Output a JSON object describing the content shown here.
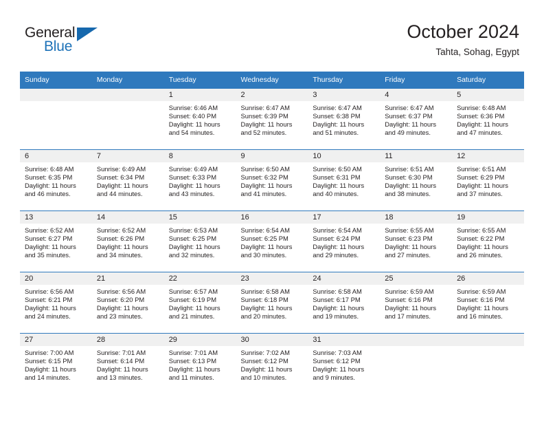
{
  "brand": {
    "line1": "General",
    "line2": "Blue",
    "flag_icon": "triangle-flag-icon",
    "accent_color": "#1668ad"
  },
  "header": {
    "title": "October 2024",
    "subtitle": "Tahta, Sohag, Egypt"
  },
  "colors": {
    "header_blue": "#2f79bd",
    "daynum_band": "#f0f0f0",
    "text": "#231f20"
  },
  "weekday_headers": [
    "Sunday",
    "Monday",
    "Tuesday",
    "Wednesday",
    "Thursday",
    "Friday",
    "Saturday"
  ],
  "weeks": [
    [
      {
        "day": "",
        "sunrise": "",
        "sunset": "",
        "daylight_line1": "",
        "daylight_line2": ""
      },
      {
        "day": "",
        "sunrise": "",
        "sunset": "",
        "daylight_line1": "",
        "daylight_line2": ""
      },
      {
        "day": "1",
        "sunrise": "Sunrise: 6:46 AM",
        "sunset": "Sunset: 6:40 PM",
        "daylight_line1": "Daylight: 11 hours",
        "daylight_line2": "and 54 minutes."
      },
      {
        "day": "2",
        "sunrise": "Sunrise: 6:47 AM",
        "sunset": "Sunset: 6:39 PM",
        "daylight_line1": "Daylight: 11 hours",
        "daylight_line2": "and 52 minutes."
      },
      {
        "day": "3",
        "sunrise": "Sunrise: 6:47 AM",
        "sunset": "Sunset: 6:38 PM",
        "daylight_line1": "Daylight: 11 hours",
        "daylight_line2": "and 51 minutes."
      },
      {
        "day": "4",
        "sunrise": "Sunrise: 6:47 AM",
        "sunset": "Sunset: 6:37 PM",
        "daylight_line1": "Daylight: 11 hours",
        "daylight_line2": "and 49 minutes."
      },
      {
        "day": "5",
        "sunrise": "Sunrise: 6:48 AM",
        "sunset": "Sunset: 6:36 PM",
        "daylight_line1": "Daylight: 11 hours",
        "daylight_line2": "and 47 minutes."
      }
    ],
    [
      {
        "day": "6",
        "sunrise": "Sunrise: 6:48 AM",
        "sunset": "Sunset: 6:35 PM",
        "daylight_line1": "Daylight: 11 hours",
        "daylight_line2": "and 46 minutes."
      },
      {
        "day": "7",
        "sunrise": "Sunrise: 6:49 AM",
        "sunset": "Sunset: 6:34 PM",
        "daylight_line1": "Daylight: 11 hours",
        "daylight_line2": "and 44 minutes."
      },
      {
        "day": "8",
        "sunrise": "Sunrise: 6:49 AM",
        "sunset": "Sunset: 6:33 PM",
        "daylight_line1": "Daylight: 11 hours",
        "daylight_line2": "and 43 minutes."
      },
      {
        "day": "9",
        "sunrise": "Sunrise: 6:50 AM",
        "sunset": "Sunset: 6:32 PM",
        "daylight_line1": "Daylight: 11 hours",
        "daylight_line2": "and 41 minutes."
      },
      {
        "day": "10",
        "sunrise": "Sunrise: 6:50 AM",
        "sunset": "Sunset: 6:31 PM",
        "daylight_line1": "Daylight: 11 hours",
        "daylight_line2": "and 40 minutes."
      },
      {
        "day": "11",
        "sunrise": "Sunrise: 6:51 AM",
        "sunset": "Sunset: 6:30 PM",
        "daylight_line1": "Daylight: 11 hours",
        "daylight_line2": "and 38 minutes."
      },
      {
        "day": "12",
        "sunrise": "Sunrise: 6:51 AM",
        "sunset": "Sunset: 6:29 PM",
        "daylight_line1": "Daylight: 11 hours",
        "daylight_line2": "and 37 minutes."
      }
    ],
    [
      {
        "day": "13",
        "sunrise": "Sunrise: 6:52 AM",
        "sunset": "Sunset: 6:27 PM",
        "daylight_line1": "Daylight: 11 hours",
        "daylight_line2": "and 35 minutes."
      },
      {
        "day": "14",
        "sunrise": "Sunrise: 6:52 AM",
        "sunset": "Sunset: 6:26 PM",
        "daylight_line1": "Daylight: 11 hours",
        "daylight_line2": "and 34 minutes."
      },
      {
        "day": "15",
        "sunrise": "Sunrise: 6:53 AM",
        "sunset": "Sunset: 6:25 PM",
        "daylight_line1": "Daylight: 11 hours",
        "daylight_line2": "and 32 minutes."
      },
      {
        "day": "16",
        "sunrise": "Sunrise: 6:54 AM",
        "sunset": "Sunset: 6:25 PM",
        "daylight_line1": "Daylight: 11 hours",
        "daylight_line2": "and 30 minutes."
      },
      {
        "day": "17",
        "sunrise": "Sunrise: 6:54 AM",
        "sunset": "Sunset: 6:24 PM",
        "daylight_line1": "Daylight: 11 hours",
        "daylight_line2": "and 29 minutes."
      },
      {
        "day": "18",
        "sunrise": "Sunrise: 6:55 AM",
        "sunset": "Sunset: 6:23 PM",
        "daylight_line1": "Daylight: 11 hours",
        "daylight_line2": "and 27 minutes."
      },
      {
        "day": "19",
        "sunrise": "Sunrise: 6:55 AM",
        "sunset": "Sunset: 6:22 PM",
        "daylight_line1": "Daylight: 11 hours",
        "daylight_line2": "and 26 minutes."
      }
    ],
    [
      {
        "day": "20",
        "sunrise": "Sunrise: 6:56 AM",
        "sunset": "Sunset: 6:21 PM",
        "daylight_line1": "Daylight: 11 hours",
        "daylight_line2": "and 24 minutes."
      },
      {
        "day": "21",
        "sunrise": "Sunrise: 6:56 AM",
        "sunset": "Sunset: 6:20 PM",
        "daylight_line1": "Daylight: 11 hours",
        "daylight_line2": "and 23 minutes."
      },
      {
        "day": "22",
        "sunrise": "Sunrise: 6:57 AM",
        "sunset": "Sunset: 6:19 PM",
        "daylight_line1": "Daylight: 11 hours",
        "daylight_line2": "and 21 minutes."
      },
      {
        "day": "23",
        "sunrise": "Sunrise: 6:58 AM",
        "sunset": "Sunset: 6:18 PM",
        "daylight_line1": "Daylight: 11 hours",
        "daylight_line2": "and 20 minutes."
      },
      {
        "day": "24",
        "sunrise": "Sunrise: 6:58 AM",
        "sunset": "Sunset: 6:17 PM",
        "daylight_line1": "Daylight: 11 hours",
        "daylight_line2": "and 19 minutes."
      },
      {
        "day": "25",
        "sunrise": "Sunrise: 6:59 AM",
        "sunset": "Sunset: 6:16 PM",
        "daylight_line1": "Daylight: 11 hours",
        "daylight_line2": "and 17 minutes."
      },
      {
        "day": "26",
        "sunrise": "Sunrise: 6:59 AM",
        "sunset": "Sunset: 6:16 PM",
        "daylight_line1": "Daylight: 11 hours",
        "daylight_line2": "and 16 minutes."
      }
    ],
    [
      {
        "day": "27",
        "sunrise": "Sunrise: 7:00 AM",
        "sunset": "Sunset: 6:15 PM",
        "daylight_line1": "Daylight: 11 hours",
        "daylight_line2": "and 14 minutes."
      },
      {
        "day": "28",
        "sunrise": "Sunrise: 7:01 AM",
        "sunset": "Sunset: 6:14 PM",
        "daylight_line1": "Daylight: 11 hours",
        "daylight_line2": "and 13 minutes."
      },
      {
        "day": "29",
        "sunrise": "Sunrise: 7:01 AM",
        "sunset": "Sunset: 6:13 PM",
        "daylight_line1": "Daylight: 11 hours",
        "daylight_line2": "and 11 minutes."
      },
      {
        "day": "30",
        "sunrise": "Sunrise: 7:02 AM",
        "sunset": "Sunset: 6:12 PM",
        "daylight_line1": "Daylight: 11 hours",
        "daylight_line2": "and 10 minutes."
      },
      {
        "day": "31",
        "sunrise": "Sunrise: 7:03 AM",
        "sunset": "Sunset: 6:12 PM",
        "daylight_line1": "Daylight: 11 hours",
        "daylight_line2": "and 9 minutes."
      },
      {
        "day": "",
        "sunrise": "",
        "sunset": "",
        "daylight_line1": "",
        "daylight_line2": ""
      },
      {
        "day": "",
        "sunrise": "",
        "sunset": "",
        "daylight_line1": "",
        "daylight_line2": ""
      }
    ]
  ]
}
